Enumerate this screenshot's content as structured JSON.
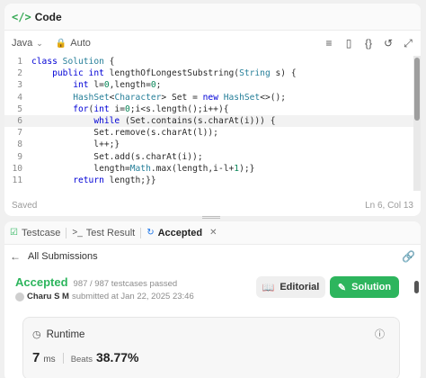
{
  "code_panel": {
    "icon": "code-icon",
    "title": "Code",
    "language": "Java",
    "mode": "Auto",
    "tools": [
      "format-icon",
      "bookmark-icon",
      "braces-icon",
      "undo-icon",
      "fullscreen-icon"
    ],
    "lines": [
      {
        "n": "1",
        "text": "class Solution {"
      },
      {
        "n": "2",
        "text": "    public int lengthOfLongestSubstring(String s) {"
      },
      {
        "n": "3",
        "text": "        int l=0,length=0;"
      },
      {
        "n": "4",
        "text": "        HashSet<Character> Set = new HashSet<>();"
      },
      {
        "n": "5",
        "text": "        for(int i=0;i<s.length();i++){"
      },
      {
        "n": "6",
        "text": "            while (Set.contains(s.charAt(i))) {"
      },
      {
        "n": "7",
        "text": "            Set.remove(s.charAt(l));"
      },
      {
        "n": "8",
        "text": "            l++;}"
      },
      {
        "n": "9",
        "text": "            Set.add(s.charAt(i));"
      },
      {
        "n": "10",
        "text": "            length=Math.max(length,i-l+1);}"
      },
      {
        "n": "11",
        "text": "        return length;}}"
      }
    ],
    "active_line": 6,
    "status_left": "Saved",
    "status_right": "Ln 6, Col 13"
  },
  "result_panel": {
    "tabs": [
      {
        "icon": "checkbox-icon",
        "label": "Testcase"
      },
      {
        "icon": "terminal-icon",
        "label": "Test Result"
      },
      {
        "icon": "history-icon",
        "label": "Accepted",
        "active": true
      }
    ],
    "back_label": "All Submissions",
    "status": "Accepted",
    "passed": "987 / 987 testcases passed",
    "submitter_name": "Charu S M",
    "submitted_text": "submitted at Jan 22, 2025 23:46",
    "editorial_label": "Editorial",
    "solution_label": "Solution",
    "runtime": {
      "label": "Runtime",
      "value": "7",
      "unit": "ms",
      "beats_label": "Beats",
      "beats_pct": "38.77%"
    }
  },
  "colors": {
    "accent_green": "#2db55d",
    "keyword_blue": "#0000d6",
    "type_teal": "#267f99"
  }
}
